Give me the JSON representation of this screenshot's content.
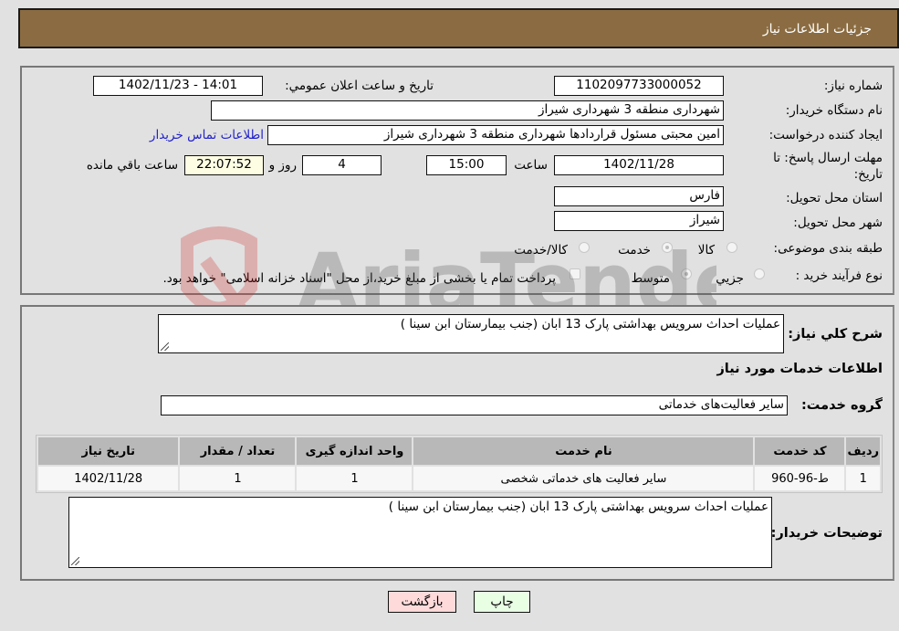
{
  "header": {
    "title": "جزئیات اطلاعات نیاز"
  },
  "form": {
    "need_number": {
      "label": "شماره نیاز:",
      "value": "1102097733000052"
    },
    "announce_datetime": {
      "label": "تاریخ و ساعت اعلان عمومي:",
      "value": "1402/11/23 - 14:01"
    },
    "buyer_org": {
      "label": "نام دستگاه خریدار:",
      "value": "شهرداری منطقه 3 شهرداری شیراز"
    },
    "requester": {
      "label": "ایجاد کننده درخواست:",
      "value": "امین محبتی مسئول قراردادها شهرداری منطقه 3 شهرداری شیراز"
    },
    "buyer_contact_link": "اطلاعات تماس خریدار",
    "deadline": {
      "label_line1": "مهلت ارسال پاسخ: تا",
      "label_line2": "تاریخ:",
      "date": "1402/11/28",
      "time_label": "ساعت",
      "time": "15:00",
      "days": "4",
      "days_label": "روز و",
      "remaining": "22:07:52",
      "remaining_label": "ساعت باقي مانده"
    },
    "province": {
      "label": "استان محل تحویل:",
      "value": "فارس"
    },
    "city": {
      "label": "شهر محل تحویل:",
      "value": "شیراز"
    },
    "category": {
      "label": "طبقه بندی موضوعی:",
      "options": [
        "کالا",
        "خدمت",
        "کالا/خدمت"
      ],
      "selected": "خدمت"
    },
    "purchase_type": {
      "label": "نوع فرآیند خرید :",
      "options": [
        "جزیي",
        "متوسط"
      ],
      "selected": "متوسط",
      "treasury_note": "پرداخت تمام یا بخشی از مبلغ خرید،از محل \"اسناد خزانه اسلامی\" خواهد بود."
    }
  },
  "details": {
    "summary_label": "شرح کلي نیاز:",
    "summary_value": "عملیات احداث سرویس بهداشتی پارک 13 ابان (جنب بیمارستان ابن سینا )",
    "services_heading": "اطلاعات خدمات مورد نیاز",
    "service_group_label": "گروه خدمت:",
    "service_group_value": "سایر فعالیت‌های خدماتی",
    "table": {
      "headers": [
        "ردیف",
        "کد خدمت",
        "نام خدمت",
        "واحد اندازه گیری",
        "تعداد / مقدار",
        "تاریخ نیاز"
      ],
      "rows": [
        [
          "1",
          "ط-96-960",
          "سایر فعالیت های خدماتی شخصی",
          "1",
          "1",
          "1402/11/28"
        ]
      ]
    },
    "buyer_notes_label": "توضیحات خریدار:",
    "buyer_notes_value": "عملیات احداث سرویس بهداشتی پارک 13 ابان (جنب بیمارستان ابن سینا )"
  },
  "buttons": {
    "print": "چاپ",
    "back": "بازگشت"
  },
  "watermark": {
    "text": "AriaTender.neT"
  }
}
